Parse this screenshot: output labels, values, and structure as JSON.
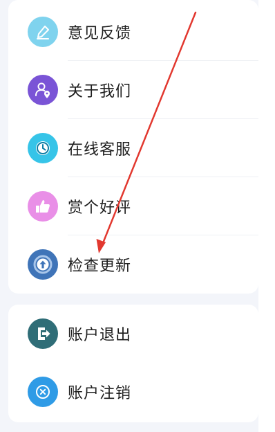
{
  "menu": {
    "items": [
      {
        "label": "意见反馈",
        "icon": "edit-icon",
        "color": "#7fd3ee"
      },
      {
        "label": "关于我们",
        "icon": "user-location-icon",
        "color": "#7a54d6"
      },
      {
        "label": "在线客服",
        "icon": "clock-icon",
        "color": "#36c4e8"
      },
      {
        "label": "赏个好评",
        "icon": "thumbs-up-icon",
        "color": "#e98fe7"
      },
      {
        "label": "检查更新",
        "icon": "update-arrow-icon",
        "color": "#3f74b8"
      }
    ]
  },
  "account": {
    "items": [
      {
        "label": "账户退出",
        "icon": "logout-icon",
        "color": "#2f6d77"
      },
      {
        "label": "账户注销",
        "icon": "cancel-icon",
        "color": "#2f9be6"
      }
    ]
  },
  "annotation": {
    "color": "#e2382f"
  }
}
